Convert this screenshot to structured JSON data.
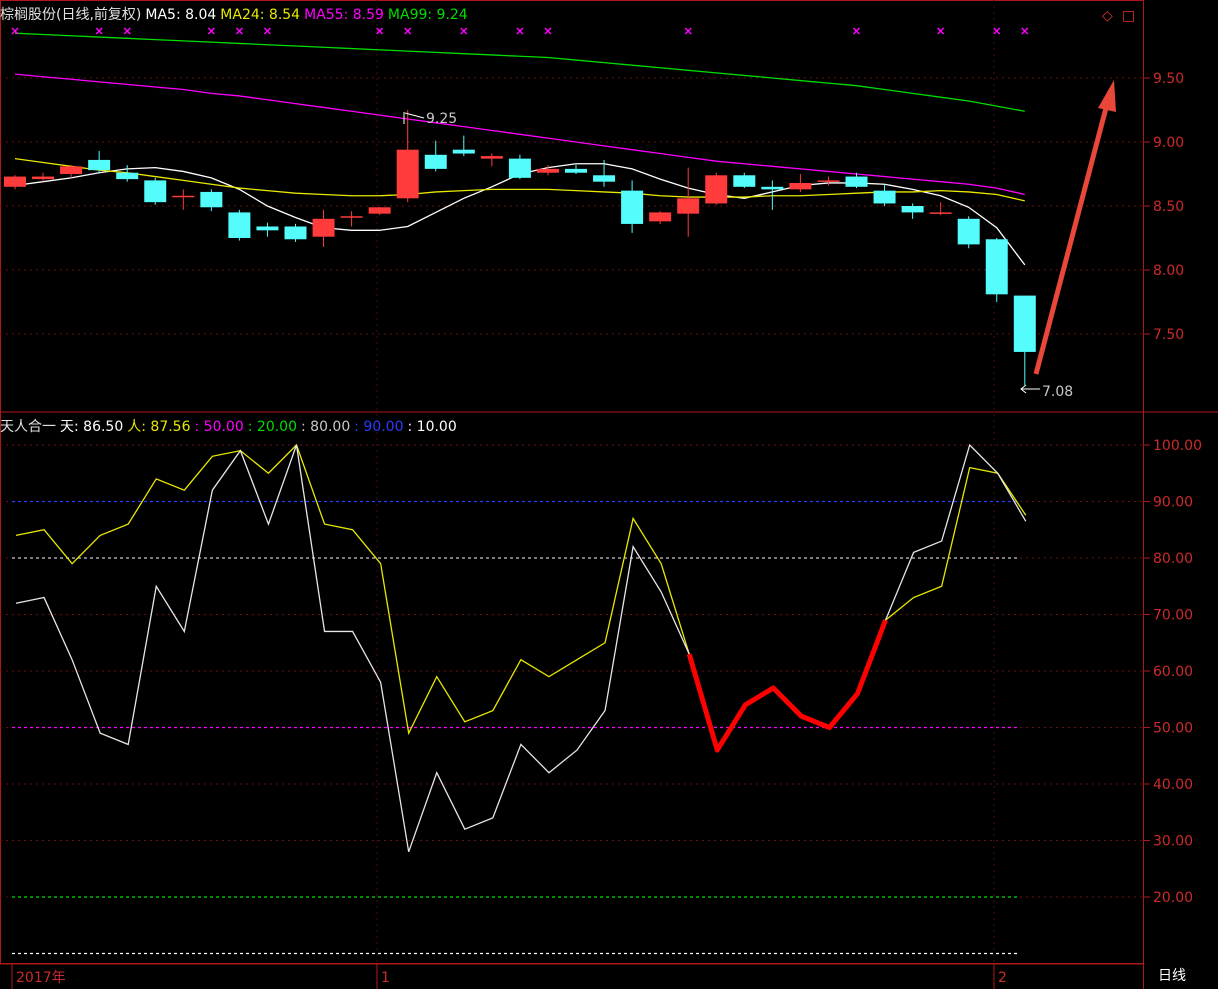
{
  "top_header": {
    "stock": "棕榈股份(日线,前复权)",
    "ma5": "MA5: 8.04",
    "ma24": "MA24: 8.54",
    "ma55": "MA55: 8.59",
    "ma99": "MA99: 9.24"
  },
  "bottom_header": {
    "indicator": "天人合一",
    "tian": "天: 86.50",
    "ren": "人: 87.56",
    "l50": ": 50.00",
    "l20": ": 20.00",
    "l80": ": 80.00",
    "l90": ": 90.00",
    "l10": ": 10.00"
  },
  "price_high_label": "9.25",
  "price_low_label": "7.08",
  "period_label": "日线",
  "x_labels": [
    "2017年",
    "1",
    "2"
  ],
  "colors": {
    "up": "#ff3b3b",
    "down": "#54fcfc",
    "ma5": "#ffffff",
    "ma24": "#e8e800",
    "ma55": "#ff00ff",
    "ma99": "#00dd00",
    "frame": "#b01818",
    "axis_text": "#cc2b2b",
    "highlight": "#ff0000",
    "arrow": "#e8473a"
  },
  "chart_data": [
    {
      "type": "candlestick",
      "y_ticks": [
        "9.50",
        "9.00",
        "8.50",
        "8.00",
        "7.50"
      ],
      "ylim": [
        7.0,
        9.95
      ],
      "candles": [
        {
          "o": 8.65,
          "h": 8.74,
          "l": 8.63,
          "c": 8.73
        },
        {
          "o": 8.71,
          "h": 8.76,
          "l": 8.69,
          "c": 8.73
        },
        {
          "o": 8.75,
          "h": 8.82,
          "l": 8.72,
          "c": 8.81
        },
        {
          "o": 8.86,
          "h": 8.93,
          "l": 8.76,
          "c": 8.78
        },
        {
          "o": 8.76,
          "h": 8.82,
          "l": 8.69,
          "c": 8.71
        },
        {
          "o": 8.7,
          "h": 8.72,
          "l": 8.51,
          "c": 8.53
        },
        {
          "o": 8.57,
          "h": 8.63,
          "l": 8.47,
          "c": 8.58
        },
        {
          "o": 8.61,
          "h": 8.63,
          "l": 8.46,
          "c": 8.49
        },
        {
          "o": 8.45,
          "h": 8.47,
          "l": 8.23,
          "c": 8.25
        },
        {
          "o": 8.34,
          "h": 8.37,
          "l": 8.26,
          "c": 8.31
        },
        {
          "o": 8.34,
          "h": 8.36,
          "l": 8.22,
          "c": 8.24
        },
        {
          "o": 8.26,
          "h": 8.47,
          "l": 8.18,
          "c": 8.4
        },
        {
          "o": 8.41,
          "h": 8.46,
          "l": 8.34,
          "c": 8.42
        },
        {
          "o": 8.44,
          "h": 8.49,
          "l": 8.43,
          "c": 8.49
        },
        {
          "o": 8.56,
          "h": 9.25,
          "l": 8.53,
          "c": 8.94
        },
        {
          "o": 8.9,
          "h": 9.01,
          "l": 8.77,
          "c": 8.79
        },
        {
          "o": 8.94,
          "h": 9.05,
          "l": 8.89,
          "c": 8.91
        },
        {
          "o": 8.87,
          "h": 8.91,
          "l": 8.81,
          "c": 8.89
        },
        {
          "o": 8.87,
          "h": 8.9,
          "l": 8.71,
          "c": 8.72
        },
        {
          "o": 8.76,
          "h": 8.82,
          "l": 8.74,
          "c": 8.79
        },
        {
          "o": 8.79,
          "h": 8.82,
          "l": 8.75,
          "c": 8.76
        },
        {
          "o": 8.74,
          "h": 8.86,
          "l": 8.65,
          "c": 8.69
        },
        {
          "o": 8.62,
          "h": 8.7,
          "l": 8.29,
          "c": 8.36
        },
        {
          "o": 8.38,
          "h": 8.46,
          "l": 8.36,
          "c": 8.45
        },
        {
          "o": 8.44,
          "h": 8.8,
          "l": 8.26,
          "c": 8.56
        },
        {
          "o": 8.52,
          "h": 8.76,
          "l": 8.51,
          "c": 8.74
        },
        {
          "o": 8.74,
          "h": 8.76,
          "l": 8.64,
          "c": 8.65
        },
        {
          "o": 8.65,
          "h": 8.7,
          "l": 8.47,
          "c": 8.63
        },
        {
          "o": 8.63,
          "h": 8.75,
          "l": 8.61,
          "c": 8.68
        },
        {
          "o": 8.69,
          "h": 8.73,
          "l": 8.66,
          "c": 8.7
        },
        {
          "o": 8.73,
          "h": 8.76,
          "l": 8.64,
          "c": 8.65
        },
        {
          "o": 8.62,
          "h": 8.67,
          "l": 8.5,
          "c": 8.52
        },
        {
          "o": 8.5,
          "h": 8.52,
          "l": 8.4,
          "c": 8.45
        },
        {
          "o": 8.45,
          "h": 8.53,
          "l": 8.43,
          "c": 8.45
        },
        {
          "o": 8.4,
          "h": 8.42,
          "l": 8.17,
          "c": 8.2
        },
        {
          "o": 8.24,
          "h": 8.25,
          "l": 7.75,
          "c": 7.81
        },
        {
          "o": 7.8,
          "h": 7.8,
          "l": 7.1,
          "c": 7.36
        }
      ],
      "ma_series": [
        {
          "name": "MA5",
          "values": [
            8.66,
            8.69,
            8.72,
            8.76,
            8.79,
            8.8,
            8.77,
            8.72,
            8.63,
            8.5,
            8.41,
            8.33,
            8.31,
            8.31,
            8.34,
            8.45,
            8.56,
            8.65,
            8.75,
            8.8,
            8.83,
            8.83,
            8.79,
            8.71,
            8.64,
            8.59,
            8.56,
            8.61,
            8.66,
            8.68,
            8.68,
            8.67,
            8.63,
            8.58,
            8.49,
            8.33,
            8.04
          ]
        },
        {
          "name": "MA24",
          "values": [
            8.87,
            8.84,
            8.81,
            8.78,
            8.76,
            8.73,
            8.7,
            8.67,
            8.64,
            8.62,
            8.6,
            8.59,
            8.58,
            8.58,
            8.59,
            8.61,
            8.62,
            8.63,
            8.63,
            8.63,
            8.62,
            8.61,
            8.6,
            8.58,
            8.57,
            8.57,
            8.57,
            8.58,
            8.58,
            8.59,
            8.6,
            8.61,
            8.61,
            8.62,
            8.61,
            8.59,
            8.54
          ]
        },
        {
          "name": "MA55",
          "values": [
            9.53,
            9.51,
            9.49,
            9.47,
            9.45,
            9.43,
            9.41,
            9.38,
            9.36,
            9.33,
            9.3,
            9.27,
            9.24,
            9.21,
            9.18,
            9.15,
            9.12,
            9.09,
            9.06,
            9.03,
            9.0,
            8.97,
            8.94,
            8.91,
            8.88,
            8.85,
            8.83,
            8.81,
            8.79,
            8.77,
            8.75,
            8.73,
            8.71,
            8.69,
            8.67,
            8.64,
            8.59
          ]
        },
        {
          "name": "MA99",
          "values": [
            9.85,
            9.84,
            9.83,
            9.82,
            9.81,
            9.8,
            9.79,
            9.78,
            9.77,
            9.76,
            9.75,
            9.74,
            9.73,
            9.72,
            9.71,
            9.7,
            9.69,
            9.68,
            9.67,
            9.66,
            9.64,
            9.62,
            9.6,
            9.58,
            9.56,
            9.54,
            9.52,
            9.5,
            9.48,
            9.46,
            9.44,
            9.41,
            9.38,
            9.35,
            9.32,
            9.28,
            9.24
          ]
        }
      ],
      "markers": [
        0,
        3,
        4,
        7,
        8,
        9,
        13,
        14,
        16,
        18,
        19,
        24,
        30,
        33,
        35,
        36
      ]
    },
    {
      "type": "line",
      "y_ticks": [
        "100.00",
        "90.00",
        "80.00",
        "70.00",
        "60.00",
        "50.00",
        "40.00",
        "30.00",
        "20.00"
      ],
      "ylim": [
        8,
        103
      ],
      "ref_lines": [
        90,
        80,
        50,
        20,
        10
      ],
      "series": [
        {
          "name": "天",
          "values": [
            72,
            73,
            62,
            49,
            47,
            75,
            67,
            92,
            99,
            86,
            100,
            67,
            67,
            58,
            28,
            42,
            32,
            34,
            47,
            42,
            46,
            53,
            82,
            74,
            63,
            46,
            54,
            57,
            52,
            50,
            56,
            69,
            81,
            83,
            100,
            95,
            86.5
          ]
        },
        {
          "name": "人",
          "values": [
            84,
            85,
            79,
            84,
            86,
            94,
            92,
            98,
            99,
            95,
            100,
            86,
            85,
            79,
            49,
            59,
            51,
            53,
            62,
            59,
            62,
            65,
            87,
            79,
            63,
            46,
            54,
            57,
            52,
            50,
            56,
            69,
            73,
            75,
            96,
            95,
            87.56
          ]
        }
      ],
      "highlight_range": [
        24,
        31
      ]
    }
  ]
}
